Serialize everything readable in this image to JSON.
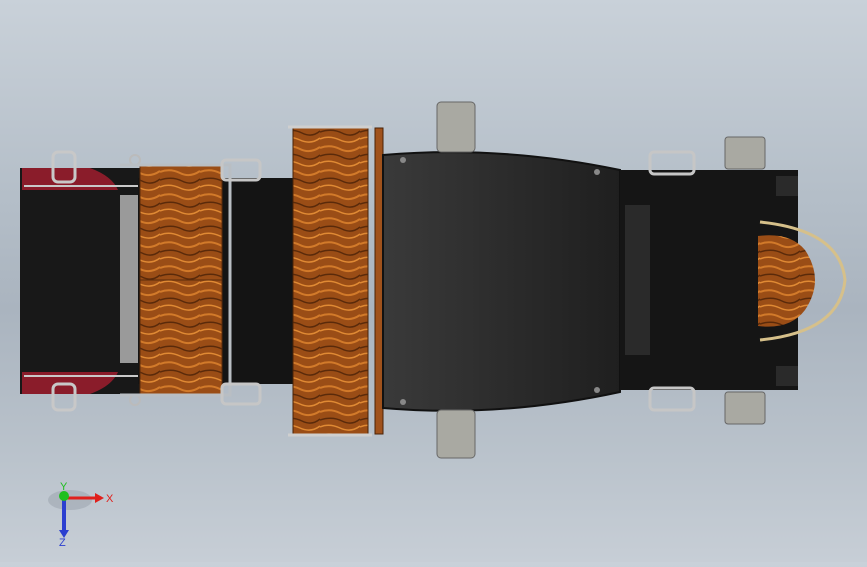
{
  "triad": {
    "x_label": "X",
    "y_label": "Y",
    "z_label": "Z",
    "x_color": "#e0201c",
    "y_color": "#1fbf1f",
    "z_color": "#2b3fd0"
  },
  "colors": {
    "body_black": "#1a1a1a",
    "seat_dark": "#2e2e2e",
    "wood": "#a0521c",
    "red_trim": "#8a1c2a",
    "rail_silver": "#bfc4c8",
    "pedal_grey": "#a9a9a2"
  }
}
